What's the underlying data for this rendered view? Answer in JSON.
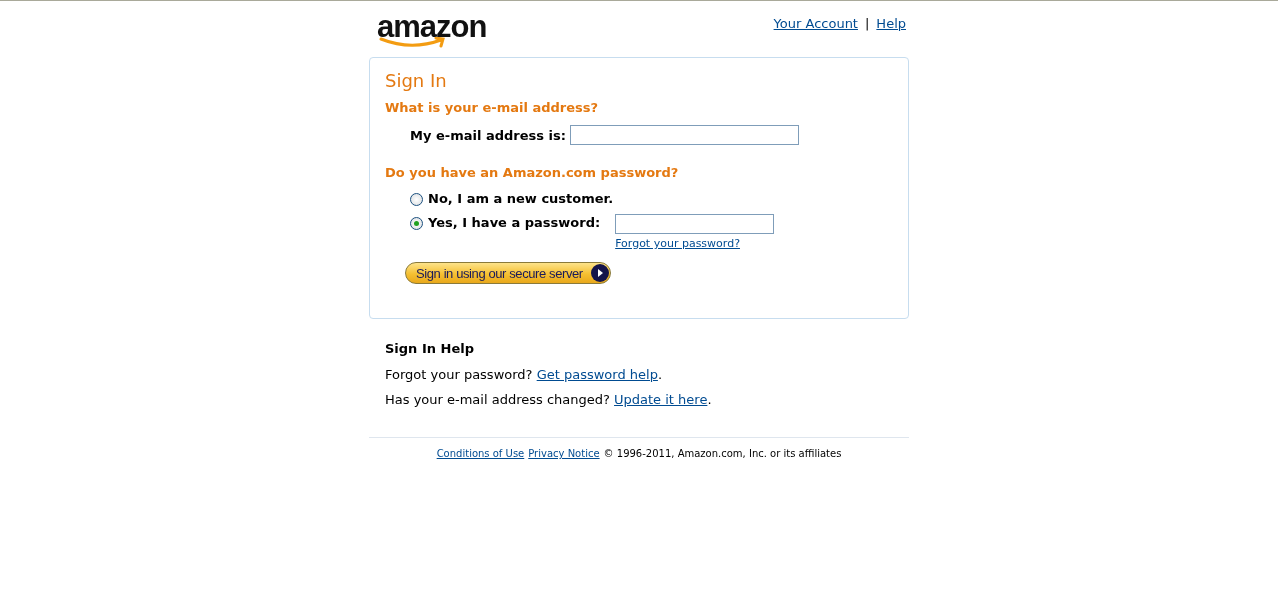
{
  "header": {
    "logo": "amazon",
    "links": [
      "Your Account",
      "Help"
    ],
    "separator": "|"
  },
  "sign_in": {
    "title": "Sign In",
    "email_question": "What is your e-mail address?",
    "email_label": "My e-mail address is:",
    "password_question": "Do you have an Amazon.com password?",
    "options": [
      {
        "label": "No, I am a new customer.",
        "selected": false,
        "kind": "plain"
      },
      {
        "label": "Yes, I have a password:",
        "selected": true,
        "kind": "password"
      }
    ],
    "forgot_link": "Forgot your password?",
    "submit": "Sign in using our secure server"
  },
  "help": {
    "title": "Sign In Help",
    "lines": [
      {
        "text": "Forgot your password?",
        "link": "Get password help",
        "end": "."
      },
      {
        "text": "Has your e-mail address changed?",
        "link": "Update it here",
        "end": "."
      }
    ]
  },
  "footer": {
    "links": [
      "Conditions of Use",
      "Privacy Notice"
    ],
    "copyright": "© 1996-2011, Amazon.com, Inc. or its affiliates"
  }
}
